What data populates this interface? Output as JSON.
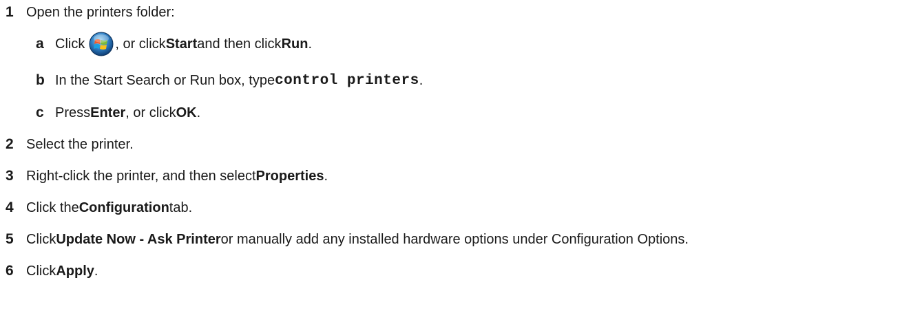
{
  "steps": [
    {
      "num": "1",
      "text": "Open the printers folder:"
    },
    {
      "num": "2",
      "text": "Select the printer."
    },
    {
      "num": "3",
      "pre": "Right-click the printer, and then select ",
      "bold": "Properties",
      "post": "."
    },
    {
      "num": "4",
      "pre": "Click the ",
      "bold": "Configuration",
      "post": " tab."
    },
    {
      "num": "5",
      "pre": "Click ",
      "bold": "Update Now - Ask Printer",
      "post": " or manually add any installed hardware options under Configuration Options."
    },
    {
      "num": "6",
      "pre": "Click ",
      "bold": "Apply",
      "post": "."
    }
  ],
  "substeps": [
    {
      "letter": "a",
      "pre": "Click",
      "icon": "windows-start-orb-icon",
      "mid": ", or click ",
      "bold1": "Start",
      "mid2": " and then click ",
      "bold2": "Run",
      "post": "."
    },
    {
      "letter": "b",
      "pre": "In the Start Search or Run box, type ",
      "code": "control printers",
      "post": "."
    },
    {
      "letter": "c",
      "pre": "Press ",
      "bold1": "Enter",
      "mid": ", or click ",
      "bold2": "OK",
      "post": "."
    }
  ]
}
